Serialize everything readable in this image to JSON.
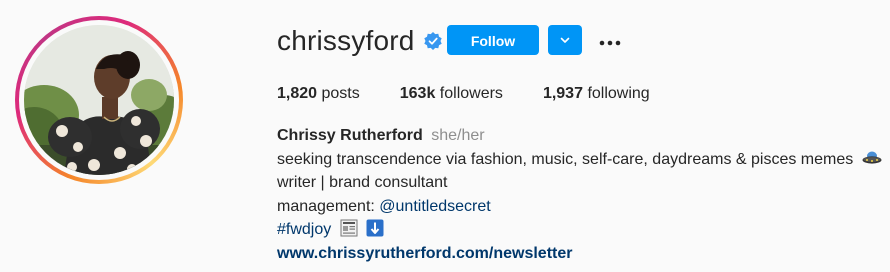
{
  "profile": {
    "username": "chrissyford",
    "follow_label": "Follow",
    "stats": {
      "posts_count": "1,820",
      "posts_label": "posts",
      "followers_count": "163k",
      "followers_label": "followers",
      "following_count": "1,937",
      "following_label": "following"
    },
    "bio": {
      "full_name": "Chrissy Rutherford",
      "pronouns": "she/her",
      "line1": "seeking transcendence via fashion, music, self-care, daydreams & pisces memes",
      "line2": "writer | brand consultant",
      "line3_prefix": "management: ",
      "line3_mention": "@untitledsecret",
      "line4_hashtag": "#fwdjoy",
      "website": "www.chrissyrutherford.com/newsletter"
    }
  },
  "icons": {
    "verified": "verified-badge-icon",
    "dropdown": "chevron-down-icon",
    "more": "more-options-icon",
    "line1_emoji": "ufo-emoji-icon",
    "hashtag_emoji1": "newspaper-emoji-icon",
    "hashtag_emoji2": "down-arrow-emoji-icon"
  },
  "colors": {
    "accent": "#0095f6",
    "link": "#00376b",
    "muted": "#8e8e8e",
    "text": "#262626"
  }
}
